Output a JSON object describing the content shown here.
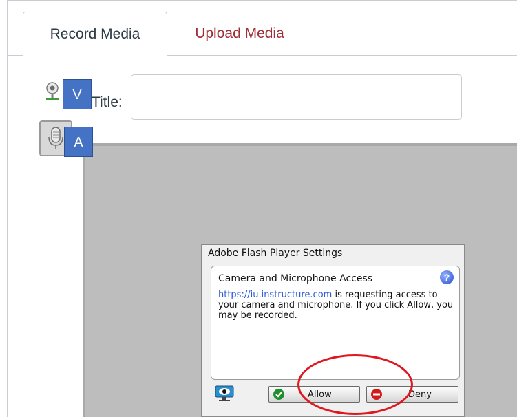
{
  "tabs": [
    {
      "label": "Record Media",
      "active": true
    },
    {
      "label": "Upload Media",
      "active": false
    }
  ],
  "form": {
    "title_label": "Title:",
    "title_value": ""
  },
  "badges": {
    "video": "V",
    "audio": "A"
  },
  "flash_dialog": {
    "window_title": "Adobe Flash Player Settings",
    "heading": "Camera and Microphone Access",
    "link_text": "https://iu.instructure.com",
    "message": " is requesting access to your camera and microphone. If you click Allow, you may be recorded.",
    "allow_label": "Allow",
    "deny_label": "Deny",
    "help_glyph": "?"
  },
  "colors": {
    "upload_tab": "#a02e36",
    "badge_bg": "#4472c4",
    "highlight": "#e0171e",
    "recorder_bg": "#bdbdbd"
  },
  "icons": [
    "webcam-icon",
    "microphone-icon",
    "help-icon",
    "camera-settings-icon",
    "allow-check-icon",
    "deny-stop-icon"
  ]
}
